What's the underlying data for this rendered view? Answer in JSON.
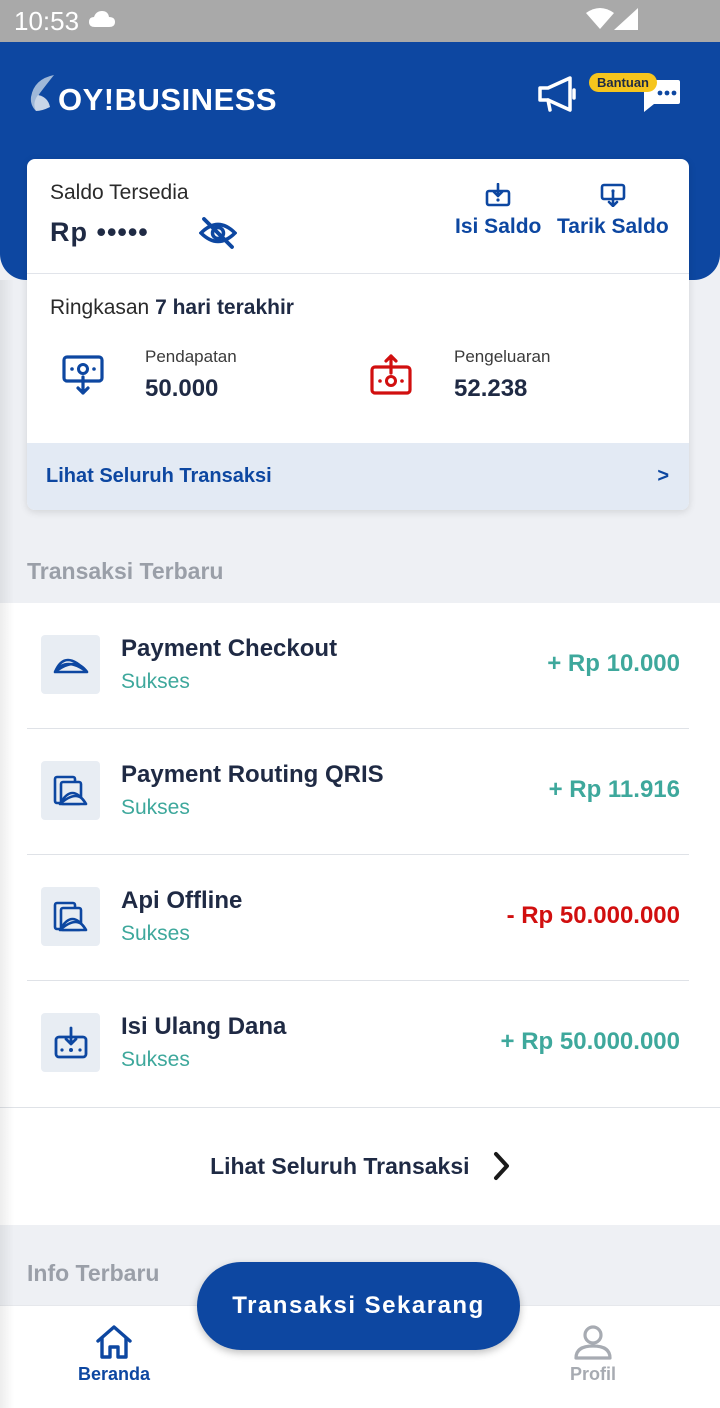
{
  "status_bar": {
    "time": "10:53"
  },
  "header": {
    "logo_text": "OY!BUSINESS",
    "help_badge": "Bantuan"
  },
  "balance_card": {
    "label": "Saldo Tersedia",
    "value_masked": "Rp •••••",
    "actions": [
      {
        "label": "Isi Saldo",
        "icon": "top-up-icon"
      },
      {
        "label": "Tarik Saldo",
        "icon": "withdraw-icon"
      }
    ],
    "summary": {
      "prefix": "Ringkasan",
      "period": "7 hari terakhir"
    },
    "income": {
      "label": "Pendapatan",
      "value": "50.000"
    },
    "expense": {
      "label": "Pengeluaran",
      "value": "52.238"
    },
    "footer_link": "Lihat Seluruh Transaksi",
    "footer_arrow": ">"
  },
  "recent_transactions": {
    "title": "Transaksi Terbaru",
    "items": [
      {
        "name": "Payment Checkout",
        "status": "Sukses",
        "amount": "+ Rp 10.000",
        "direction": "in",
        "icon": "payment-link-icon"
      },
      {
        "name": "Payment Routing QRIS",
        "status": "Sukses",
        "amount": "+ Rp 11.916",
        "direction": "in",
        "icon": "payment-routing-icon"
      },
      {
        "name": "Api Offline",
        "status": "Sukses",
        "amount": "- Rp 50.000.000",
        "direction": "out",
        "icon": "payment-routing-icon"
      },
      {
        "name": "Isi Ulang Dana",
        "status": "Sukses",
        "amount": "+ Rp 50.000.000",
        "direction": "in",
        "icon": "top-up-icon"
      }
    ],
    "see_all": "Lihat Seluruh Transaksi"
  },
  "info": {
    "title": "Info Terbaru"
  },
  "fab": {
    "label": "Transaksi Sekarang"
  },
  "bottom_nav": [
    {
      "label": "Beranda",
      "active": true
    },
    {
      "label": "Profil",
      "active": false
    }
  ],
  "colors": {
    "primary": "#0d47a1",
    "success": "#3ea89c",
    "danger": "#d10f0f",
    "badge": "#f6c51d"
  }
}
